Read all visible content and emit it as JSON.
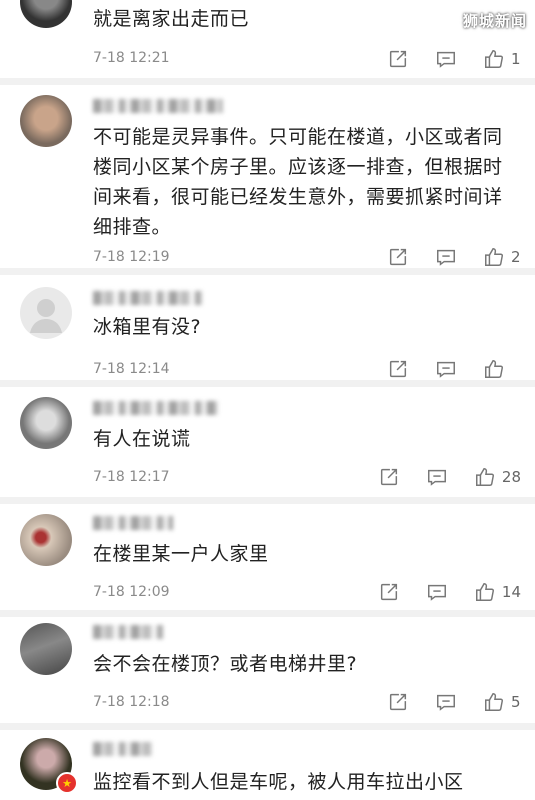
{
  "watermark": "狮城新闻",
  "comments": [
    {
      "text": "就是离家出走而已",
      "time": "7-18 12:21",
      "likes": "1"
    },
    {
      "text": "不可能是灵异事件。只可能在楼道，小区或者同楼同小区某个房子里。应该逐一排查，但根据时间来看，很可能已经发生意外，需要抓紧时间详细排查。",
      "time": "7-18 12:19",
      "likes": "2"
    },
    {
      "text": "冰箱里有没?",
      "time": "7-18 12:14",
      "likes": ""
    },
    {
      "text": "有人在说谎",
      "time": "7-18 12:17",
      "likes": "28"
    },
    {
      "text": "在楼里某一户人家里",
      "time": "7-18 12:09",
      "likes": "14"
    },
    {
      "text": "会不会在楼顶？或者电梯井里?",
      "time": "7-18 12:18",
      "likes": "5"
    },
    {
      "text": "监控看不到人但是车呢，被人用车拉出小区",
      "time": "",
      "likes": ""
    }
  ],
  "icons": {
    "share": "share-icon",
    "comment": "comment-icon",
    "like": "thumbs-up-icon",
    "badge": "vip-badge-icon"
  },
  "colors": {
    "separator": "#f1f1f1",
    "time": "#8a8a8a",
    "badge": "#e5322d"
  }
}
